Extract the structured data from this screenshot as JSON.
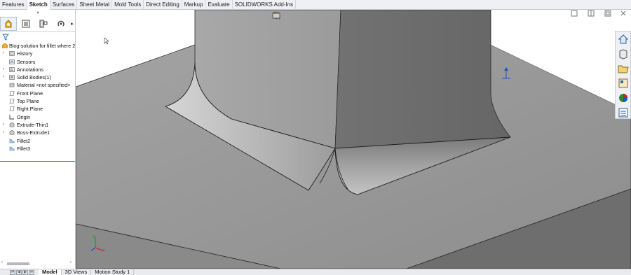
{
  "command_tabs": [
    "Features",
    "Sketch",
    "Surfaces",
    "Sheet Metal",
    "Mold Tools",
    "Direct Editing",
    "Markup",
    "Evaluate",
    "SOLIDWORKS Add-Ins"
  ],
  "active_command_tab": "Sketch",
  "tree": {
    "root": "Blog-solution for fillet where 2",
    "items": [
      {
        "label": "History",
        "expandable": true,
        "icon": "history-icon"
      },
      {
        "label": "Sensors",
        "expandable": false,
        "icon": "sensors-icon"
      },
      {
        "label": "Annotations",
        "expandable": true,
        "icon": "annotations-icon"
      },
      {
        "label": "Solid Bodies(1)",
        "expandable": true,
        "icon": "solid-bodies-icon"
      },
      {
        "label": "Material <not specified>",
        "expandable": false,
        "icon": "material-icon"
      },
      {
        "label": "Front Plane",
        "expandable": false,
        "icon": "plane-icon"
      },
      {
        "label": "Top Plane",
        "expandable": false,
        "icon": "plane-icon"
      },
      {
        "label": "Right Plane",
        "expandable": false,
        "icon": "plane-icon"
      },
      {
        "label": "Origin",
        "expandable": false,
        "icon": "origin-icon"
      },
      {
        "label": "Extrude-Thin1",
        "expandable": true,
        "icon": "extrude-icon"
      },
      {
        "label": "Boss-Extrude1",
        "expandable": true,
        "icon": "extrude-icon"
      },
      {
        "label": "Fillet2",
        "expandable": false,
        "icon": "fillet-icon"
      },
      {
        "label": "Fillet3",
        "expandable": false,
        "icon": "fillet-icon"
      }
    ]
  },
  "bottom_tabs": [
    "Model",
    "3D Views",
    "Motion Study 1"
  ],
  "active_bottom_tab": "Model",
  "colors": {
    "accent": "#2a6fb0",
    "model_face_light": "#9a9a9a",
    "model_face_dark": "#6f6f6f",
    "tab_bar": "#eef0f3"
  }
}
